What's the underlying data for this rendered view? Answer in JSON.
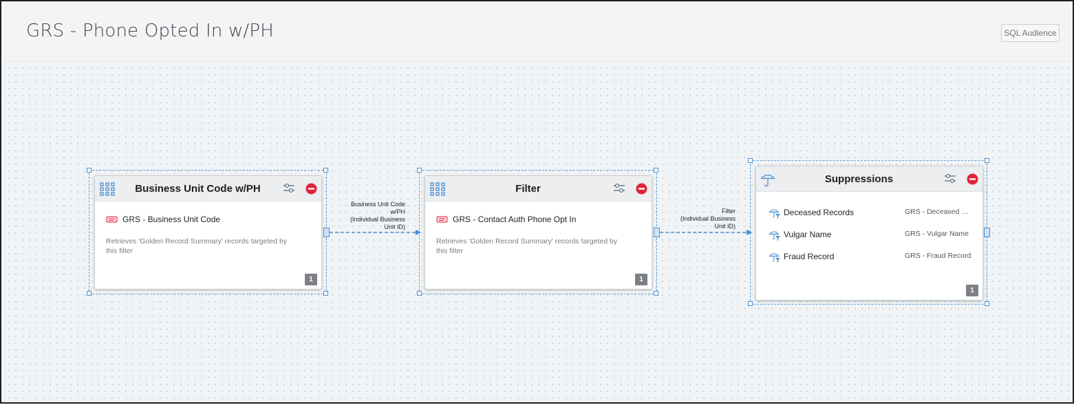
{
  "header": {
    "title": "GRS - Phone Opted In w/PH",
    "sql_button_label": "SQL Audience"
  },
  "colors": {
    "accent_blue": "#4a8dd1",
    "remove_red": "#e0243a",
    "badge_gray": "#7c8085"
  },
  "nodes": [
    {
      "title": "Business Unit Code w/PH",
      "icon": "grid-icon",
      "filter_name": "GRS - Business Unit Code",
      "description": "Retrieves 'Golden Record Summary' records targeted by this filter",
      "count": "1"
    },
    {
      "title": "Filter",
      "icon": "grid-icon",
      "filter_name": "GRS - Contact Auth Phone Opt In",
      "description": "Retrieves 'Golden Record Summary' records targeted by this filter",
      "count": "1"
    },
    {
      "title": "Suppressions",
      "icon": "umbrella-icon",
      "items": [
        {
          "label": "Deceased Records",
          "value": "GRS - Deceased Records"
        },
        {
          "label": "Vulgar Name",
          "value": "GRS - Vulgar Name"
        },
        {
          "label": "Fraud Record",
          "value": "GRS - Fraud Record"
        }
      ],
      "count": "1"
    }
  ],
  "connections": [
    {
      "label_lines": [
        "Business Unit Code",
        "w/PH",
        "(Individual Business",
        "Unit ID)"
      ]
    },
    {
      "label_lines": [
        "Filter",
        "(Individual Business",
        "Unit ID)"
      ]
    }
  ]
}
